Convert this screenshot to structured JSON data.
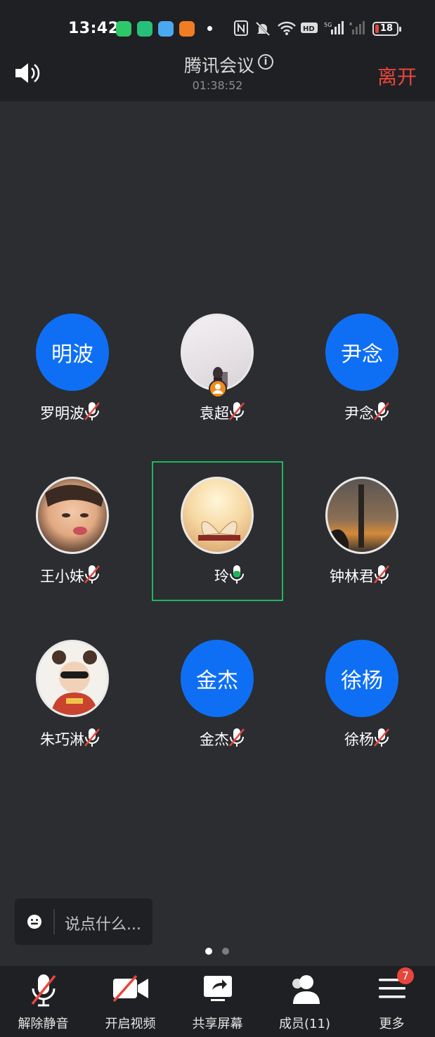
{
  "status_bar": {
    "time": "13:42",
    "network": "5G",
    "battery": "18"
  },
  "header": {
    "speaker_icon": "speaker-icon",
    "title": "腾讯会议",
    "timer": "01:38:52",
    "leave_label": "离开"
  },
  "participants": [
    {
      "name": "罗明波",
      "avatar_text": "明波",
      "muted": true
    },
    {
      "name": "袁超",
      "avatar_text": "",
      "muted": true
    },
    {
      "name": "尹念",
      "avatar_text": "尹念",
      "muted": true
    },
    {
      "name": "王小妹",
      "avatar_text": "",
      "muted": true
    },
    {
      "name": "玲",
      "avatar_text": "",
      "muted": false,
      "speaking": true
    },
    {
      "name": "钟林君",
      "avatar_text": "",
      "muted": true
    },
    {
      "name": "朱巧淋",
      "avatar_text": "",
      "muted": true
    },
    {
      "name": "金杰",
      "avatar_text": "金杰",
      "muted": true
    },
    {
      "name": "徐杨",
      "avatar_text": "徐杨",
      "muted": true
    }
  ],
  "chat": {
    "placeholder": "说点什么..."
  },
  "toolbar": {
    "unmute_label": "解除静音",
    "video_label": "开启视频",
    "share_label": "共享屏幕",
    "members_label": "成员(11)",
    "more_label": "更多",
    "more_badge": "7"
  },
  "colors": {
    "accent_blue": "#0e6ff5",
    "leave_red": "#e8453c",
    "speaking_green": "#1fb75a",
    "background": "#2b2d31",
    "bar": "#1f2023"
  }
}
